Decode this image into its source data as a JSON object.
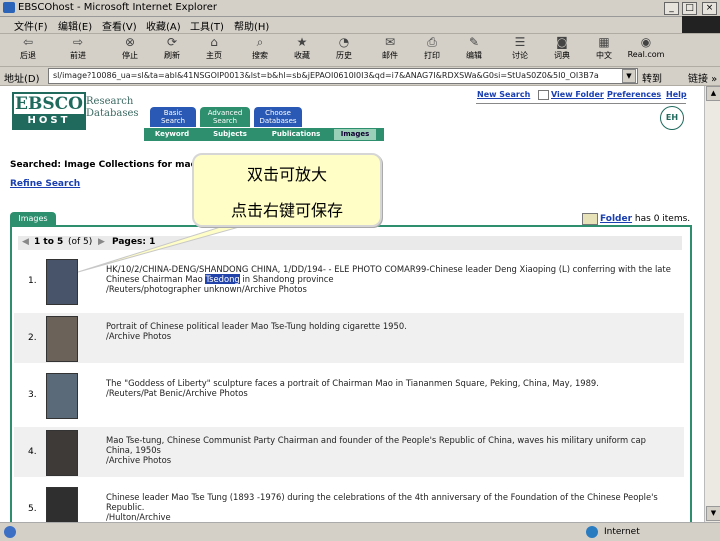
{
  "window": {
    "title": "EBSCOhost - Microsoft Internet Explorer",
    "buttons": [
      "_",
      "□",
      "×"
    ]
  },
  "menu": [
    "文件(F)",
    "编辑(E)",
    "查看(V)",
    "收藏(A)",
    "工具(T)",
    "帮助(H)"
  ],
  "toolbar": [
    {
      "label": "后退",
      "icon": "back-arrow"
    },
    {
      "label": "前进",
      "icon": "forward-arrow"
    },
    {
      "label": "停止",
      "icon": "stop"
    },
    {
      "label": "刷新",
      "icon": "refresh"
    },
    {
      "label": "主页",
      "icon": "home"
    },
    {
      "label": "搜索",
      "icon": "search"
    },
    {
      "label": "收藏",
      "icon": "favorites"
    },
    {
      "label": "历史",
      "icon": "history"
    },
    {
      "label": "邮件",
      "icon": "mail"
    },
    {
      "label": "打印",
      "icon": "print"
    },
    {
      "label": "编辑",
      "icon": "edit"
    },
    {
      "label": "讨论",
      "icon": "discuss"
    },
    {
      "label": "词典",
      "icon": "dictionary"
    },
    {
      "label": "中文",
      "icon": "chinese"
    },
    {
      "label": "Real.com",
      "icon": "real"
    }
  ],
  "address": {
    "label": "地址(D)",
    "url": "sl/image?10086_ua=sl&ta=abl&41NSGOIP0013&lst=b&hl=sb&jEPAOI0610I0I3&qd=i7&ANAG7I&RDXSWa&G0si=StUaS0Z0&5I0_OI3B7a",
    "go": "转到",
    "links": "链接 »"
  },
  "ebsco": {
    "logo_top": "EBSCO",
    "logo_bottom": "HOST",
    "research_1": "Research",
    "research_2": "Databases",
    "tabs": [
      {
        "l1": "Basic",
        "l2": "Search",
        "color": "#2a58b5"
      },
      {
        "l1": "Advanced",
        "l2": "Search",
        "color": "#2e8f6f"
      },
      {
        "l1": "Choose",
        "l2": "Databases",
        "color": "#2a58b5"
      }
    ],
    "subnav": [
      "Keyword",
      "Subjects",
      "Publications",
      "Images"
    ],
    "toplinks": [
      "New Search",
      "View Folder",
      "Preferences",
      "Help"
    ],
    "badge": "EH"
  },
  "search": {
    "searched": "Searched: Image Collections for mao",
    "refine": "Refine Search"
  },
  "callout": {
    "line1": "双击可放大",
    "line2": "点击右键可保存"
  },
  "folder": {
    "link": "Folder",
    "rest": "has 0 items."
  },
  "images_tab": "Images",
  "pager": {
    "range": "1 to 5",
    "total": "(of 5)",
    "pages": "Pages: 1"
  },
  "results": [
    {
      "num": "1.",
      "pre": "HK/10/2/CHINA-DENG/SHANDONG CHINA, 1/DD/194- - ELE PHOTO COMAR99-Chinese leader Deng Xiaoping (L) conferring with the late Chinese Chairman Mao ",
      "hl": "Tsedong",
      "post": " in Shandong province",
      "src": "/Reuters/photographer unknown/Archive Photos"
    },
    {
      "num": "2.",
      "pre": "Portrait of Chinese political leader Mao Tse-Tung holding cigarette 1950.",
      "hl": "",
      "post": "",
      "src": "/Archive Photos"
    },
    {
      "num": "3.",
      "pre": "The \"Goddess of Liberty\" sculpture faces a portrait of Chairman Mao in Tiananmen Square, Peking, China, May, 1989.",
      "hl": "",
      "post": "",
      "src": "/Reuters/Pat Benic/Archive Photos"
    },
    {
      "num": "4.",
      "pre": "Mao Tse-tung, Chinese Communist Party Chairman and founder of the People's Republic of China, waves his military uniform cap China, 1950s",
      "hl": "",
      "post": "",
      "src": "/Archive Photos"
    },
    {
      "num": "5.",
      "pre": "Chinese leader Mao Tse Tung (1893 -1976) during the celebrations of the 4th anniversary of the Foundation of the Chinese People's Republic.",
      "hl": "",
      "post": "",
      "src": "/Hulton/Archive"
    }
  ],
  "status": {
    "zone": "Internet"
  }
}
